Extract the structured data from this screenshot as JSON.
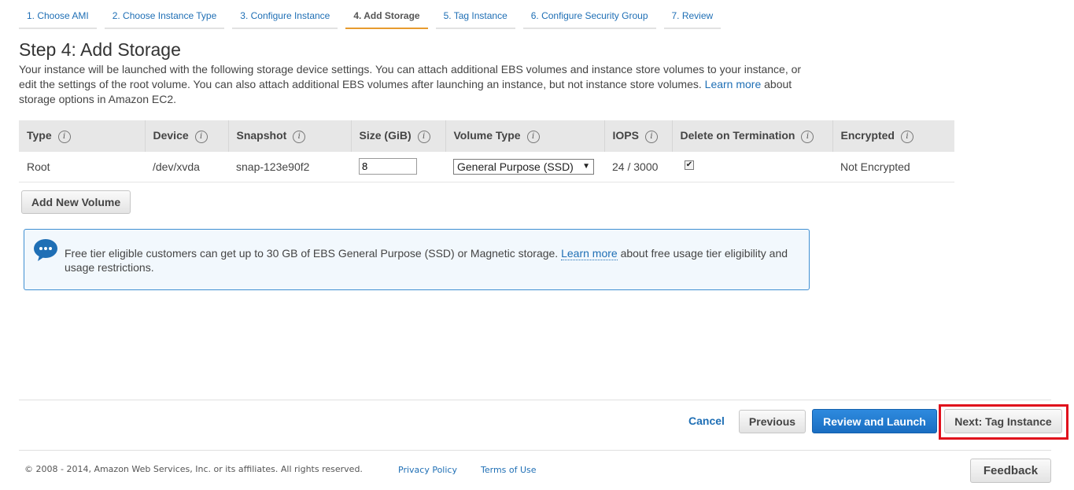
{
  "wizard": {
    "steps": [
      {
        "label": "1. Choose AMI"
      },
      {
        "label": "2. Choose Instance Type"
      },
      {
        "label": "3. Configure Instance"
      },
      {
        "label": "4. Add Storage"
      },
      {
        "label": "5. Tag Instance"
      },
      {
        "label": "6. Configure Security Group"
      },
      {
        "label": "7. Review"
      }
    ],
    "active_step": "4. Add Storage"
  },
  "page": {
    "title": "Step 4: Add Storage",
    "description_part1": "Your instance will be launched with the following storage device settings. You can attach additional EBS volumes and instance store volumes to your instance, or edit the settings of the root volume. You can also attach additional EBS volumes after launching an instance, but not instance store volumes. ",
    "description_link": "Learn more",
    "description_part2": " about storage options in Amazon EC2."
  },
  "table": {
    "columns": [
      {
        "label": "Type"
      },
      {
        "label": "Device"
      },
      {
        "label": "Snapshot"
      },
      {
        "label": "Size (GiB)"
      },
      {
        "label": "Volume Type"
      },
      {
        "label": "IOPS"
      },
      {
        "label": "Delete on Termination"
      },
      {
        "label": "Encrypted"
      }
    ],
    "info_icon": "i",
    "rows": [
      {
        "type": "Root",
        "device": "/dev/xvda",
        "snapshot": "snap-123e90f2",
        "size": "8",
        "volume_type": "General Purpose (SSD)",
        "iops": "24 / 3000",
        "delete_on_termination": true,
        "encrypted": "Not Encrypted"
      }
    ]
  },
  "add_volume_button": "Add New Volume",
  "notice": {
    "icon": "speech-bubble-icon",
    "text_part1": "Free tier eligible customers can get up to 30 GB of EBS General Purpose (SSD) or Magnetic storage. ",
    "link": "Learn more",
    "text_part2": " about free usage tier eligibility and usage restrictions."
  },
  "actions": {
    "cancel": "Cancel",
    "previous": "Previous",
    "review_and_launch": "Review and Launch",
    "next": "Next: Tag Instance"
  },
  "footer": {
    "copyright": "© 2008 - 2014, Amazon Web Services, Inc. or its affiliates. All rights reserved.",
    "privacy": "Privacy Policy",
    "terms": "Terms of Use",
    "feedback": "Feedback"
  },
  "colors": {
    "link": "#1f6fb5",
    "active_tab_underline": "#e79b2f",
    "primary_button": "#1a6ec2",
    "notice_border": "#3f8fd2",
    "highlight": "#e0101c"
  }
}
